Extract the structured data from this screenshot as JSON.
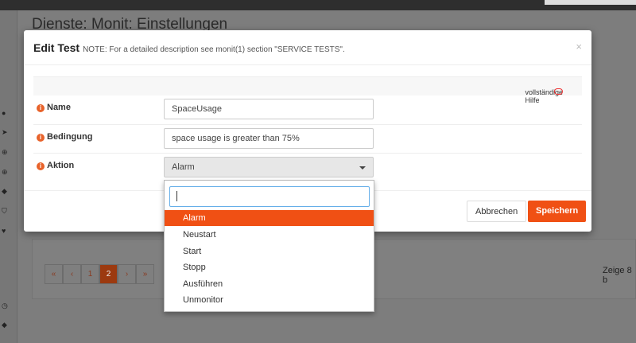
{
  "background": {
    "title": "Dienste: Monit: Einstellungen",
    "pager": [
      "«",
      "‹",
      "1",
      "2",
      "›",
      "»"
    ],
    "active_page": "2",
    "status": "Zeige 8 b"
  },
  "modal": {
    "title": "Edit Test",
    "note": "NOTE: For a detailed description see monit(1) section \"SERVICE TESTS\".",
    "close": "×",
    "help": "vollständige Hilfe",
    "fields": {
      "name_label": "Name",
      "name_value": "SpaceUsage",
      "condition_label": "Bedingung",
      "condition_value": "space usage is greater than 75%",
      "action_label": "Aktion",
      "action_value": "Alarm"
    },
    "cancel": "Abbrechen",
    "save": "Speichern"
  },
  "dropdown": {
    "search": "",
    "options": [
      "Alarm",
      "Neustart",
      "Start",
      "Stopp",
      "Ausführen",
      "Unmonitor"
    ],
    "highlighted": "Alarm"
  },
  "colors": {
    "accent": "#f05014"
  }
}
